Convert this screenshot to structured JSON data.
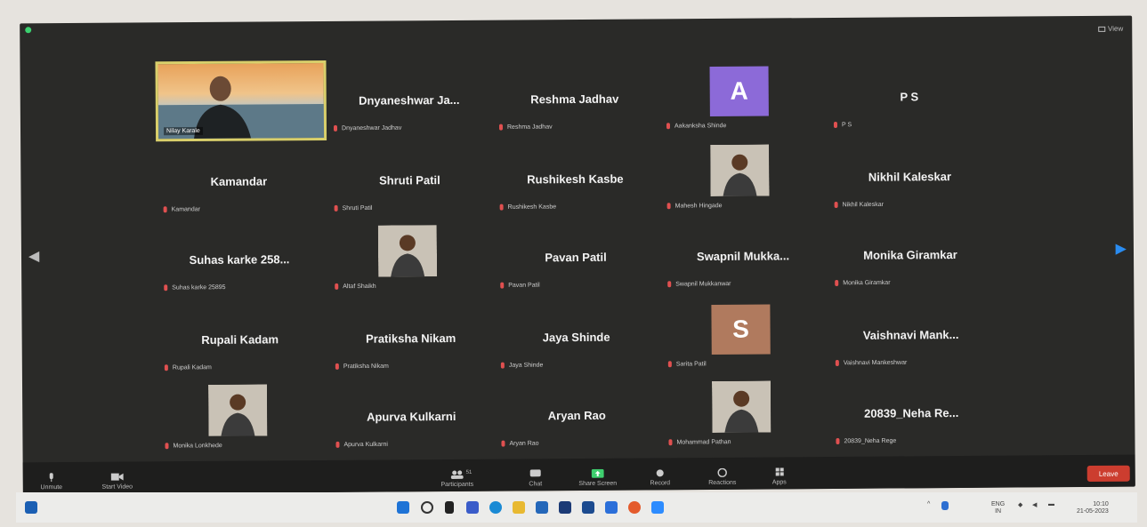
{
  "toolbar_top": {
    "view_label": "View"
  },
  "tiles": [
    {
      "name": "Dnyaneshwar  Ja...",
      "label": "Dnyaneshwar Jadhav"
    },
    {
      "name": "Reshma Jadhav",
      "label": "Reshma Jadhav"
    },
    {
      "name": "",
      "label": "Aakanksha Shinde",
      "avatar": "A",
      "avatar_color": "#8c6ad8"
    },
    {
      "name": "P S",
      "label": "P S"
    },
    {
      "name": "Kamandar",
      "label": "Kamandar"
    },
    {
      "name": "Shruti Patil",
      "label": "Shruti Patil"
    },
    {
      "name": "Rushikesh Kasbe",
      "label": "Rushikesh Kasbe"
    },
    {
      "name": "",
      "label": "Mahesh Hingade",
      "photo": true
    },
    {
      "name": "Nikhil Kaleskar",
      "label": "Nikhil Kaleskar"
    },
    {
      "name": "Suhas karke 258...",
      "label": "Suhas karke 25895"
    },
    {
      "name": "",
      "label": "Altaf Shaikh",
      "photo": true
    },
    {
      "name": "Pavan Patil",
      "label": "Pavan Patil"
    },
    {
      "name": "Swapnil  Mukka...",
      "label": "Swapnil Mukkanwar"
    },
    {
      "name": "Monika Giramkar",
      "label": "Monika Giramkar"
    },
    {
      "name": "Rupali Kadam",
      "label": "Rupali Kadam"
    },
    {
      "name": "Pratiksha Nikam",
      "label": "Pratiksha Nikam"
    },
    {
      "name": "Jaya Shinde",
      "label": "Jaya Shinde"
    },
    {
      "name": "",
      "label": "Sarita Patil",
      "avatar": "S",
      "avatar_color": "#b07a5e"
    },
    {
      "name": "Vaishnavi  Mank...",
      "label": "Vaishnavi Mankeshwar"
    },
    {
      "name": "",
      "label": "Monika Lonkhede",
      "photo": true
    },
    {
      "name": "Apurva Kulkarni",
      "label": "Apurva Kulkarni"
    },
    {
      "name": "Aryan Rao",
      "label": "Aryan Rao"
    },
    {
      "name": "",
      "label": "Mohammad Pathan",
      "photo": true
    },
    {
      "name": "20839_Neha  Re...",
      "label": "20839_Neha Rege"
    }
  ],
  "active_speaker": {
    "label": "Nilay Karale"
  },
  "meeting_toolbar": {
    "unmute": "Unmute",
    "start_video": "Start Video",
    "participants": "Participants",
    "participants_count": "51",
    "chat": "Chat",
    "share_screen": "Share Screen",
    "record": "Record",
    "reactions": "Reactions",
    "apps": "Apps",
    "leave": "Leave"
  },
  "taskbar": {
    "lang_top": "ENG",
    "lang_bottom": "IN",
    "time": "10:10",
    "date": "21-05-2023"
  }
}
